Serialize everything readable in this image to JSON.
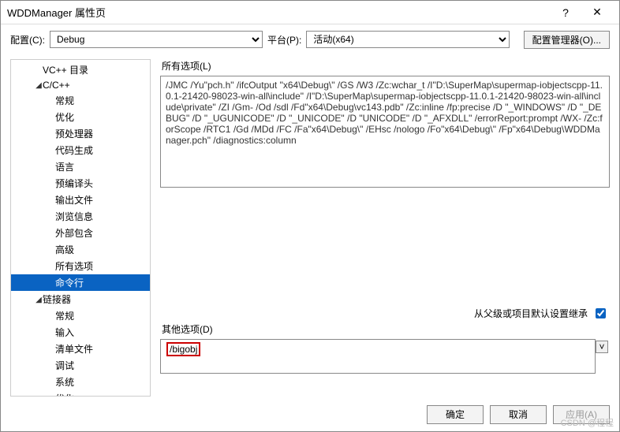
{
  "window": {
    "title": "WDDManager 属性页",
    "help": "?",
    "close": "✕"
  },
  "top": {
    "config_label": "配置(C):",
    "config_value": "Debug",
    "platform_label": "平台(P):",
    "platform_value": "活动(x64)",
    "config_mgr": "配置管理器(O)..."
  },
  "tree": {
    "vc_dir": "VC++ 目录",
    "cc": "C/C++",
    "cc_children": {
      "general": "常规",
      "optimize": "优化",
      "prepro": "预处理器",
      "codegen": "代码生成",
      "lang": "语言",
      "preheader": "预编译头",
      "outfile": "输出文件",
      "browse": "浏览信息",
      "extincl": "外部包含",
      "advanced": "高级",
      "allopt": "所有选项",
      "cmdline": "命令行"
    },
    "linker": "链接器",
    "linker_children": {
      "general": "常规",
      "input": "输入",
      "manifest": "清单文件",
      "debug": "调试",
      "system": "系统",
      "optimize": "优化"
    }
  },
  "right": {
    "all_label": "所有选项(L)",
    "all_text": "/JMC /Yu\"pch.h\" /ifcOutput \"x64\\Debug\\\" /GS /W3 /Zc:wchar_t /I\"D:\\SuperMap\\supermap-iobjectscpp-11.0.1-21420-98023-win-all\\include\" /I\"D:\\SuperMap\\supermap-iobjectscpp-11.0.1-21420-98023-win-all\\include\\private\" /ZI /Gm- /Od /sdl /Fd\"x64\\Debug\\vc143.pdb\" /Zc:inline /fp:precise /D \"_WINDOWS\" /D \"_DEBUG\" /D \"_UGUNICODE\" /D \"_UNICODE\" /D \"UNICODE\" /D \"_AFXDLL\" /errorReport:prompt /WX- /Zc:forScope /RTC1 /Gd /MDd /FC /Fa\"x64\\Debug\\\" /EHsc /nologo /Fo\"x64\\Debug\\\" /Fp\"x64\\Debug\\WDDManager.pch\" /diagnostics:column",
    "inherit_label": "从父级或项目默认设置继承",
    "addl_label": "其他选项(D)",
    "addl_value": "/bigobj",
    "expand": "˅"
  },
  "footer": {
    "ok": "确定",
    "cancel": "取消",
    "apply": "应用(A)"
  },
  "watermark": "CSDN @程程"
}
